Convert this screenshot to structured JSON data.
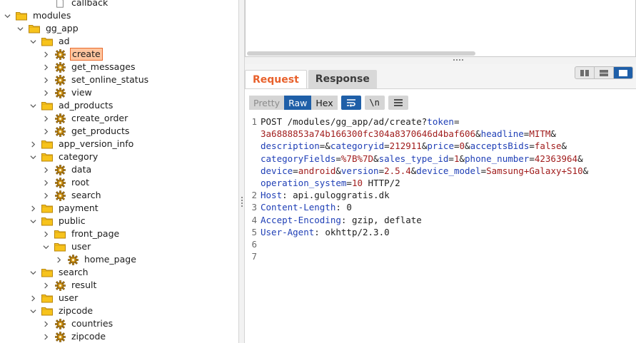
{
  "tree": [
    {
      "label": "callback",
      "depth": 3,
      "icon": "page-icon",
      "chevron": "none",
      "row": -1
    },
    {
      "label": "modules",
      "depth": 0,
      "icon": "folder-icon",
      "chevron": "down",
      "row": 0
    },
    {
      "label": "gg_app",
      "depth": 1,
      "icon": "folder-icon",
      "chevron": "down",
      "row": 1
    },
    {
      "label": "ad",
      "depth": 2,
      "icon": "folder-icon",
      "chevron": "down",
      "row": 2
    },
    {
      "label": "create",
      "depth": 3,
      "icon": "gear-icon",
      "chevron": "right",
      "row": 3,
      "selected": true
    },
    {
      "label": "get_messages",
      "depth": 3,
      "icon": "gear-icon",
      "chevron": "right",
      "row": 4
    },
    {
      "label": "set_online_status",
      "depth": 3,
      "icon": "gear-icon",
      "chevron": "right",
      "row": 5
    },
    {
      "label": "view",
      "depth": 3,
      "icon": "gear-icon",
      "chevron": "right",
      "row": 6
    },
    {
      "label": "ad_products",
      "depth": 2,
      "icon": "folder-icon",
      "chevron": "down",
      "row": 7
    },
    {
      "label": "create_order",
      "depth": 3,
      "icon": "gear-icon",
      "chevron": "right",
      "row": 8
    },
    {
      "label": "get_products",
      "depth": 3,
      "icon": "gear-icon",
      "chevron": "right",
      "row": 9
    },
    {
      "label": "app_version_info",
      "depth": 2,
      "icon": "folder-icon",
      "chevron": "right",
      "row": 10
    },
    {
      "label": "category",
      "depth": 2,
      "icon": "folder-icon",
      "chevron": "down",
      "row": 11
    },
    {
      "label": "data",
      "depth": 3,
      "icon": "gear-icon",
      "chevron": "right",
      "row": 12
    },
    {
      "label": "root",
      "depth": 3,
      "icon": "gear-icon",
      "chevron": "right",
      "row": 13
    },
    {
      "label": "search",
      "depth": 3,
      "icon": "gear-icon",
      "chevron": "right",
      "row": 14
    },
    {
      "label": "payment",
      "depth": 2,
      "icon": "folder-icon",
      "chevron": "right",
      "row": 15
    },
    {
      "label": "public",
      "depth": 2,
      "icon": "folder-icon",
      "chevron": "down",
      "row": 16
    },
    {
      "label": "front_page",
      "depth": 3,
      "icon": "folder-icon",
      "chevron": "right",
      "row": 17
    },
    {
      "label": "user",
      "depth": 3,
      "icon": "folder-icon",
      "chevron": "down",
      "row": 18
    },
    {
      "label": "home_page",
      "depth": 4,
      "icon": "gear-icon",
      "chevron": "right",
      "row": 19
    },
    {
      "label": "search",
      "depth": 2,
      "icon": "folder-icon",
      "chevron": "down",
      "row": 20
    },
    {
      "label": "result",
      "depth": 3,
      "icon": "gear-icon",
      "chevron": "right",
      "row": 21
    },
    {
      "label": "user",
      "depth": 2,
      "icon": "folder-icon",
      "chevron": "right",
      "row": 22
    },
    {
      "label": "zipcode",
      "depth": 2,
      "icon": "folder-icon",
      "chevron": "down",
      "row": 23
    },
    {
      "label": "countries",
      "depth": 3,
      "icon": "gear-icon",
      "chevron": "right",
      "row": 24
    },
    {
      "label": "zipcode",
      "depth": 3,
      "icon": "gear-icon",
      "chevron": "right",
      "row": 25
    }
  ],
  "tabs": {
    "request": "Request",
    "response": "Response"
  },
  "toolbar": {
    "pretty": "Pretty",
    "raw": "Raw",
    "hex": "Hex",
    "newline": "\\n"
  },
  "colors": {
    "accent": "#e8612c",
    "selected_bg": "#ffc59e",
    "active_blue": "#1f5fa8",
    "param_key": "#1f3fb6",
    "param_value": "#a11d1d"
  },
  "request": {
    "lines": [
      {
        "num": "1",
        "parts": [
          {
            "t": "POST /modules/gg_app/ad/create?",
            "c": "plain"
          },
          {
            "t": "token",
            "c": "k"
          },
          {
            "t": "=",
            "c": "plain"
          }
        ]
      },
      {
        "num": "",
        "parts": [
          {
            "t": "3a6888853a74b166300fc304a8370646d4baf606",
            "c": "v"
          },
          {
            "t": "&",
            "c": "plain"
          },
          {
            "t": "headline",
            "c": "k"
          },
          {
            "t": "=",
            "c": "plain"
          },
          {
            "t": "MITM",
            "c": "v"
          },
          {
            "t": "&",
            "c": "plain"
          }
        ]
      },
      {
        "num": "",
        "parts": [
          {
            "t": "description",
            "c": "k"
          },
          {
            "t": "=&",
            "c": "plain"
          },
          {
            "t": "categoryid",
            "c": "k"
          },
          {
            "t": "=",
            "c": "plain"
          },
          {
            "t": "212911",
            "c": "v"
          },
          {
            "t": "&",
            "c": "plain"
          },
          {
            "t": "price",
            "c": "k"
          },
          {
            "t": "=",
            "c": "plain"
          },
          {
            "t": "0",
            "c": "v"
          },
          {
            "t": "&",
            "c": "plain"
          },
          {
            "t": "acceptsBids",
            "c": "k"
          },
          {
            "t": "=",
            "c": "plain"
          },
          {
            "t": "false",
            "c": "v"
          },
          {
            "t": "&",
            "c": "plain"
          }
        ]
      },
      {
        "num": "",
        "parts": [
          {
            "t": "categoryFields",
            "c": "k"
          },
          {
            "t": "=",
            "c": "plain"
          },
          {
            "t": "%7B%7D",
            "c": "v"
          },
          {
            "t": "&",
            "c": "plain"
          },
          {
            "t": "sales_type_id",
            "c": "k"
          },
          {
            "t": "=",
            "c": "plain"
          },
          {
            "t": "1",
            "c": "v"
          },
          {
            "t": "&",
            "c": "plain"
          },
          {
            "t": "phone_number",
            "c": "k"
          },
          {
            "t": "=",
            "c": "plain"
          },
          {
            "t": "42363964",
            "c": "v"
          },
          {
            "t": "&",
            "c": "plain"
          }
        ]
      },
      {
        "num": "",
        "parts": [
          {
            "t": "device",
            "c": "k"
          },
          {
            "t": "=",
            "c": "plain"
          },
          {
            "t": "android",
            "c": "v"
          },
          {
            "t": "&",
            "c": "plain"
          },
          {
            "t": "version",
            "c": "k"
          },
          {
            "t": "=",
            "c": "plain"
          },
          {
            "t": "2.5.4",
            "c": "v"
          },
          {
            "t": "&",
            "c": "plain"
          },
          {
            "t": "device_model",
            "c": "k"
          },
          {
            "t": "=",
            "c": "plain"
          },
          {
            "t": "Samsung+Galaxy+S10",
            "c": "v"
          },
          {
            "t": "&",
            "c": "plain"
          }
        ]
      },
      {
        "num": "",
        "parts": [
          {
            "t": "operation_system",
            "c": "k"
          },
          {
            "t": "=",
            "c": "plain"
          },
          {
            "t": "10",
            "c": "v"
          },
          {
            "t": " HTTP/2",
            "c": "plain"
          }
        ]
      },
      {
        "num": "2",
        "parts": [
          {
            "t": "Host",
            "c": "k"
          },
          {
            "t": ": api.guloggratis.dk",
            "c": "plain"
          }
        ]
      },
      {
        "num": "3",
        "parts": [
          {
            "t": "Content-Length",
            "c": "k"
          },
          {
            "t": ": 0",
            "c": "plain"
          }
        ]
      },
      {
        "num": "4",
        "parts": [
          {
            "t": "Accept-Encoding",
            "c": "k"
          },
          {
            "t": ": gzip, deflate",
            "c": "plain"
          }
        ]
      },
      {
        "num": "5",
        "parts": [
          {
            "t": "User-Agent",
            "c": "k"
          },
          {
            "t": ": okhttp/2.3.0",
            "c": "plain"
          }
        ]
      },
      {
        "num": "6",
        "parts": []
      },
      {
        "num": "7",
        "parts": []
      }
    ]
  }
}
